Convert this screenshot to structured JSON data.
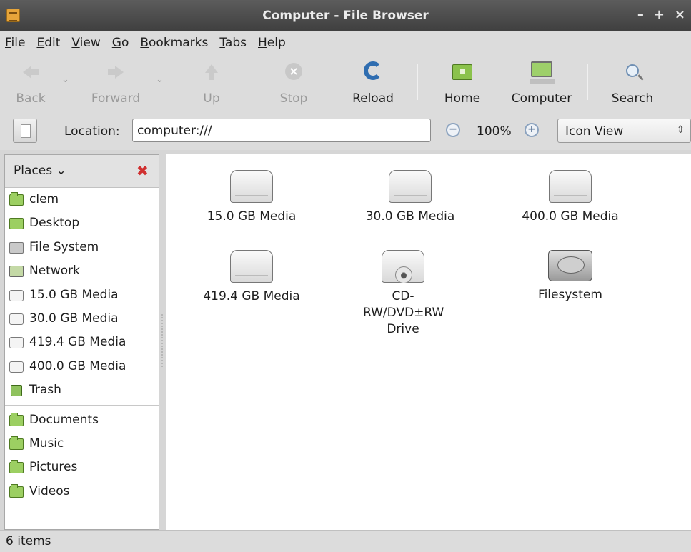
{
  "window": {
    "title": "Computer - File Browser",
    "controls": [
      "–",
      "+",
      "×"
    ]
  },
  "menubar": {
    "items": [
      {
        "mnemonic": "F",
        "rest": "ile"
      },
      {
        "mnemonic": "E",
        "rest": "dit"
      },
      {
        "mnemonic": "V",
        "rest": "iew"
      },
      {
        "mnemonic": "G",
        "rest": "o"
      },
      {
        "mnemonic": "B",
        "rest": "ookmarks"
      },
      {
        "mnemonic": "T",
        "rest": "abs"
      },
      {
        "mnemonic": "H",
        "rest": "elp"
      }
    ]
  },
  "toolbar": {
    "back": "Back",
    "forward": "Forward",
    "up": "Up",
    "stop": "Stop",
    "reload": "Reload",
    "home": "Home",
    "computer": "Computer",
    "search": "Search",
    "icons": {
      "back": "arrow-left-icon",
      "forward": "arrow-right-icon",
      "up": "arrow-up-icon",
      "stop": "stop-icon",
      "reload": "reload-icon",
      "home": "home-folder-icon",
      "computer": "computer-icon",
      "search": "magnifier-icon"
    }
  },
  "location": {
    "label": "Location:",
    "value": "computer:///",
    "zoom": "100%",
    "view_mode": "Icon View"
  },
  "sidebar": {
    "header": "Places",
    "items": [
      {
        "label": "clem",
        "icon": "home-folder-icon"
      },
      {
        "label": "Desktop",
        "icon": "desktop-icon"
      },
      {
        "label": "File System",
        "icon": "filesystem-icon"
      },
      {
        "label": "Network",
        "icon": "network-icon"
      },
      {
        "label": "15.0 GB Media",
        "icon": "drive-icon"
      },
      {
        "label": "30.0 GB Media",
        "icon": "drive-icon"
      },
      {
        "label": "419.4 GB Media",
        "icon": "drive-icon"
      },
      {
        "label": "400.0 GB Media",
        "icon": "drive-icon"
      },
      {
        "label": "Trash",
        "icon": "trash-icon"
      }
    ],
    "bookmarks": [
      {
        "label": "Documents",
        "icon": "folder-icon"
      },
      {
        "label": "Music",
        "icon": "folder-icon"
      },
      {
        "label": "Pictures",
        "icon": "folder-icon"
      },
      {
        "label": "Videos",
        "icon": "folder-icon"
      }
    ]
  },
  "main": {
    "items": [
      {
        "label": "15.0 GB Media",
        "icon": "drive-icon"
      },
      {
        "label": "30.0 GB Media",
        "icon": "drive-icon"
      },
      {
        "label": "400.0 GB Media",
        "icon": "drive-icon"
      },
      {
        "label": "419.4 GB Media",
        "icon": "drive-icon"
      },
      {
        "label": "CD-RW/DVD±RW Drive",
        "icon": "optical-drive-icon"
      },
      {
        "label": "Filesystem",
        "icon": "harddisk-icon"
      }
    ]
  },
  "status": {
    "text": "6 items"
  },
  "colors": {
    "reload_accent": "#2f6db0",
    "folder_green": "#9ccf62",
    "close_red": "#d03030"
  }
}
